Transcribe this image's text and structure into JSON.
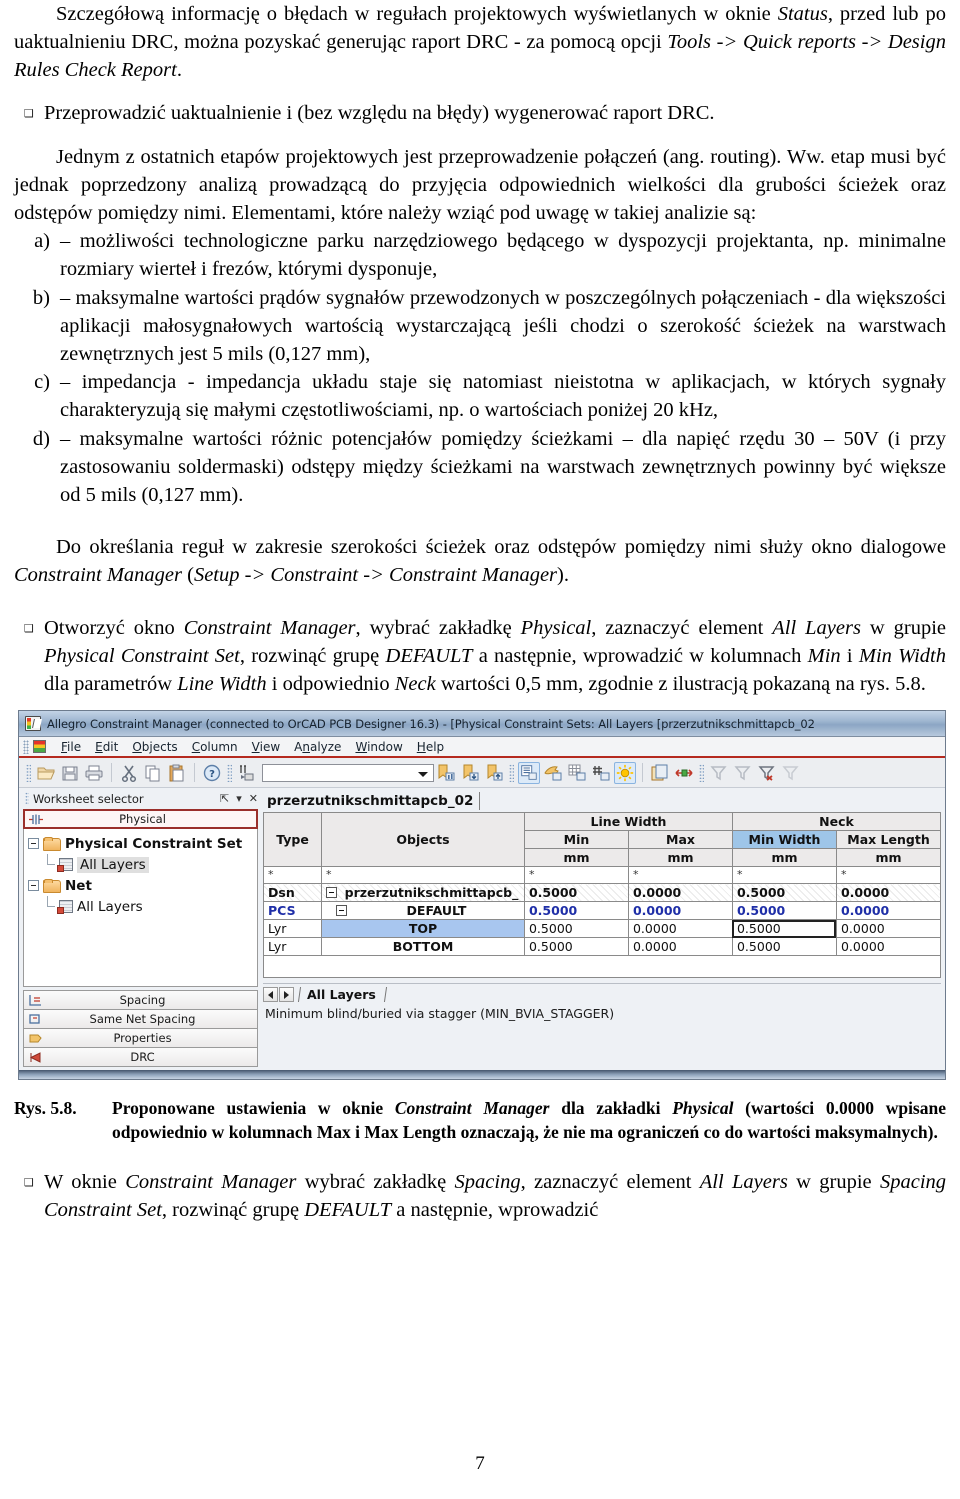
{
  "document": {
    "paragraphs": [
      {
        "id": "p1",
        "runs": [
          {
            "t": "Szczegółową informację o błędach w regułach projektowych wyświetlanych w oknie ",
            "s": "n"
          },
          {
            "t": "Status",
            "s": "i"
          },
          {
            "t": ", przed lub po uaktualnieniu DRC, można pozyskać generując raport DRC - za pomocą opcji ",
            "s": "n"
          },
          {
            "t": "Tools -> Quick reports -> Design Rules Check Report",
            "s": "i"
          },
          {
            "t": ".",
            "s": "n"
          }
        ]
      }
    ],
    "bullet1": "Przeprowadzić uaktualnienie i (bez względu na błędy) wygenerować raport DRC.",
    "p2": "Jednym z ostatnich etapów projektowych jest przeprowadzenie połączeń (ang. routing). Ww. etap musi być jednak poprzedzony analizą prowadzącą do przyjęcia odpowiednich wielkości dla grubości ścieżek oraz odstępów pomiędzy nimi. Elementami, które należy wziąć pod uwagę w takiej analizie są:",
    "list": [
      {
        "label": "a)",
        "text": "– możliwości technologiczne parku narzędziowego będącego w dyspozycji projektanta, np. minimalne rozmiary wierteł i frezów, którymi dysponuje,"
      },
      {
        "label": "b)",
        "text": "– maksymalne wartości prądów sygnałów przewodzonych w poszczególnych połączeniach - dla większości aplikacji małosygnałowych wartością wystarczającą jeśli chodzi o szerokość ścieżek na warstwach zewnętrznych jest 5 mils (0,127 mm),"
      },
      {
        "label": "c)",
        "text": "– impedancja - impedancja układu staje się natomiast nieistotna w aplikacjach, w których sygnały charakteryzują się małymi częstotliwościami, np. o wartościach poniżej 20 kHz,"
      },
      {
        "label": "d)",
        "text": "– maksymalne wartości różnic potencjałów pomiędzy ścieżkami – dla napięć rzędu 30 – 50V (i przy zastosowaniu soldermaski) odstępy między ścieżkami na warstwach zewnętrznych powinny być większe od 5 mils (0,127 mm)."
      }
    ],
    "p3_runs": [
      {
        "t": "Do określania reguł w zakresie szerokości ścieżek oraz odstępów pomiędzy nimi służy okno dialogowe ",
        "s": "n"
      },
      {
        "t": "Constraint Manager ",
        "s": "i"
      },
      {
        "t": "(",
        "s": "n"
      },
      {
        "t": "Setup -> Constraint -> Constraint Manager",
        "s": "i"
      },
      {
        "t": ").",
        "s": "n"
      }
    ],
    "bullet2_runs": [
      {
        "t": "Otworzyć okno ",
        "s": "n"
      },
      {
        "t": "Constraint Manager",
        "s": "i"
      },
      {
        "t": ", wybrać zakładkę ",
        "s": "n"
      },
      {
        "t": "Physical",
        "s": "i"
      },
      {
        "t": ", zaznaczyć element ",
        "s": "n"
      },
      {
        "t": "All Layers",
        "s": "i"
      },
      {
        "t": " w grupie ",
        "s": "n"
      },
      {
        "t": "Physical Constraint Set",
        "s": "i"
      },
      {
        "t": ", rozwinąć grupę ",
        "s": "n"
      },
      {
        "t": "DEFAULT",
        "s": "i"
      },
      {
        "t": " a następnie, wprowadzić w kolumnach ",
        "s": "n"
      },
      {
        "t": "Min",
        "s": "i"
      },
      {
        "t": " i ",
        "s": "n"
      },
      {
        "t": "Min Width",
        "s": "i"
      },
      {
        "t": " dla parametrów ",
        "s": "n"
      },
      {
        "t": "Line Width",
        "s": "i"
      },
      {
        "t": " i odpowiednio ",
        "s": "n"
      },
      {
        "t": "Neck",
        "s": "i"
      },
      {
        "t": " wartości 0,5 mm, zgodnie z ilustracją pokazaną na rys. 5.8.",
        "s": "n"
      }
    ],
    "caption": {
      "label": "Rys. 5.8.",
      "runs": [
        {
          "t": "Proponowane ustawienia w oknie ",
          "s": "b"
        },
        {
          "t": "Constraint Manager",
          "s": "bi"
        },
        {
          "t": " dla zakładki ",
          "s": "b"
        },
        {
          "t": "Physical",
          "s": "bi"
        },
        {
          "t": " (wartości 0.0000 wpisane odpowiednio w kolumnach Max i Max Length oznaczają, że nie ma ograniczeń co do wartości maksymalnych).",
          "s": "b"
        }
      ]
    },
    "bullet3_runs": [
      {
        "t": "W oknie ",
        "s": "n"
      },
      {
        "t": "Constraint Manager",
        "s": "i"
      },
      {
        "t": " wybrać zakładkę ",
        "s": "n"
      },
      {
        "t": "Spacing",
        "s": "i"
      },
      {
        "t": ", zaznaczyć element ",
        "s": "n"
      },
      {
        "t": "All Layers",
        "s": "i"
      },
      {
        "t": " w grupie ",
        "s": "n"
      },
      {
        "t": "Spacing Constraint Set",
        "s": "i"
      },
      {
        "t": ", rozwinąć grupę ",
        "s": "n"
      },
      {
        "t": "DEFAULT",
        "s": "i"
      },
      {
        "t": " a następnie, wprowadzić",
        "s": "n"
      }
    ],
    "page_number": "7",
    "bullet_glyph": "❑"
  },
  "screenshot": {
    "titlebar": {
      "title": "Allegro Constraint Manager (connected to OrCAD PCB Designer 16.3) - [Physical Constraint Sets:  All Layers [przerzutnikschmittapcb_02"
    },
    "menubar": {
      "items": [
        {
          "pre": "",
          "acc": "F",
          "post": "ile"
        },
        {
          "pre": "",
          "acc": "E",
          "post": "dit"
        },
        {
          "pre": "",
          "acc": "O",
          "post": "bjects"
        },
        {
          "pre": "",
          "acc": "C",
          "post": "olumn"
        },
        {
          "pre": "",
          "acc": "V",
          "post": "iew"
        },
        {
          "pre": "A",
          "acc": "n",
          "post": "alyze"
        },
        {
          "pre": "",
          "acc": "W",
          "post": "indow"
        },
        {
          "pre": "",
          "acc": "H",
          "post": "elp"
        }
      ]
    },
    "toolbar": {
      "icons": [
        "open-folder-icon",
        "save-icon",
        "print-icon",
        "cut-scissors-icon",
        "copy-icon",
        "paste-icon",
        "help-question-icon",
        "find-icon"
      ],
      "combo_value": "",
      "right_icons": [
        "bookmark-chart-icon",
        "bookmark-down-icon",
        "bookmark-up-icon",
        "show-list-icon",
        "mode-icon",
        "grid-icon",
        "hash-icon",
        "highlight-sun-icon",
        "copy-window-icon",
        "resize-icon",
        "filter-refresh-icon",
        "filter-clear-icon",
        "filter-remove-icon",
        "filter-extra-icon"
      ]
    },
    "left_panel": {
      "header": {
        "title": "Worksheet selector",
        "pin_icon": "pin-icon",
        "menu_icon": "chevron-down-icon",
        "close_icon": "close-icon"
      },
      "selected_worksheet": "Physical",
      "tree": [
        {
          "level": 0,
          "label": "Physical Constraint Set",
          "type": "folder",
          "bold": true,
          "expanded": true
        },
        {
          "level": 1,
          "label": "All Layers",
          "type": "sheet",
          "bold": false,
          "selected": true
        },
        {
          "level": 0,
          "label": "Net",
          "type": "folder",
          "bold": true,
          "expanded": true
        },
        {
          "level": 1,
          "label": "All Layers",
          "type": "sheet",
          "bold": false,
          "selected": false
        }
      ],
      "bottom_buttons": [
        {
          "label": "Spacing",
          "icon": "spacing-icon"
        },
        {
          "label": "Same Net Spacing",
          "icon": "same-net-spacing-icon"
        },
        {
          "label": "Properties",
          "icon": "properties-icon"
        },
        {
          "label": "DRC",
          "icon": "drc-icon"
        }
      ]
    },
    "right_panel": {
      "sheet_title": "przerzutnikschmittapcb_02",
      "group_headers": [
        {
          "label": "Line Width",
          "span": 2
        },
        {
          "label": "Neck",
          "span": 2
        }
      ],
      "columns": [
        {
          "key": "type",
          "label": "Type"
        },
        {
          "key": "objects",
          "label": "Objects"
        },
        {
          "key": "lw_min",
          "label": "Min",
          "unit": "mm"
        },
        {
          "key": "lw_max",
          "label": "Max",
          "unit": "mm"
        },
        {
          "key": "neck_min_width",
          "label": "Min Width",
          "unit": "mm",
          "highlighted": true
        },
        {
          "key": "neck_max_length",
          "label": "Max Length",
          "unit": "mm"
        }
      ],
      "filter_row": [
        "*",
        "*",
        "*",
        "*",
        "*",
        "*"
      ],
      "rows": [
        {
          "style": "dsn",
          "type": "Dsn",
          "object": "przerzutnikschmittapcb_",
          "indent": 0,
          "expander": true,
          "lw_min": "0.5000",
          "lw_max": "0.0000",
          "neck_min_width": "0.5000",
          "neck_max_length": "0.0000"
        },
        {
          "style": "pcs",
          "type": "PCS",
          "object": "DEFAULT",
          "indent": 1,
          "expander": true,
          "lw_min": "0.5000",
          "lw_max": "0.0000",
          "neck_min_width": "0.5000",
          "neck_max_length": "0.0000"
        },
        {
          "style": "lyr",
          "type": "Lyr",
          "object": "TOP",
          "indent": 2,
          "expander": false,
          "row_selected": true,
          "cell_selected": "neck_min_width",
          "lw_min": "0.5000",
          "lw_max": "0.0000",
          "neck_min_width": "0.5000",
          "neck_max_length": "0.0000"
        },
        {
          "style": "lyr",
          "type": "Lyr",
          "object": "BOTTOM",
          "indent": 2,
          "expander": false,
          "lw_min": "0.5000",
          "lw_max": "0.0000",
          "neck_min_width": "0.5000",
          "neck_max_length": "0.0000"
        }
      ],
      "tab_label": "All Layers",
      "status_text": "Minimum blind/buried via stagger (MIN_BVIA_STAGGER)"
    },
    "colors": {
      "header_highlight": "#9ec5e8",
      "row_highlight": "#a8c6ef",
      "pcs_text": "#1f2fa8",
      "menubar_accent": "#b52a1f",
      "selected_worksheet_border": "#9a2f2b"
    }
  }
}
